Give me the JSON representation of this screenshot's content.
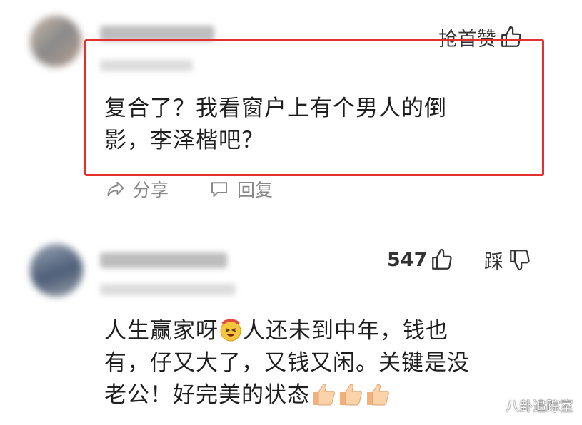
{
  "comments": [
    {
      "like_label": "抢首赞",
      "text_line1": "复合了？我看窗户上有个男人的倒",
      "text_line2": "影，李泽楷吧？",
      "share_label": "分享",
      "reply_label": "回复"
    },
    {
      "like_count": "547",
      "dislike_label": "踩",
      "text_line1_a": "人生赢家呀",
      "text_line1_b": "人还未到中年，钱也",
      "text_line2": "有，仔又大了，又钱又闲。关键是没",
      "text_line3": "老公！好完美的状态"
    }
  ],
  "watermark": "八卦追踪室",
  "colors": {
    "highlight": "#e5312e",
    "muted": "#888888"
  }
}
